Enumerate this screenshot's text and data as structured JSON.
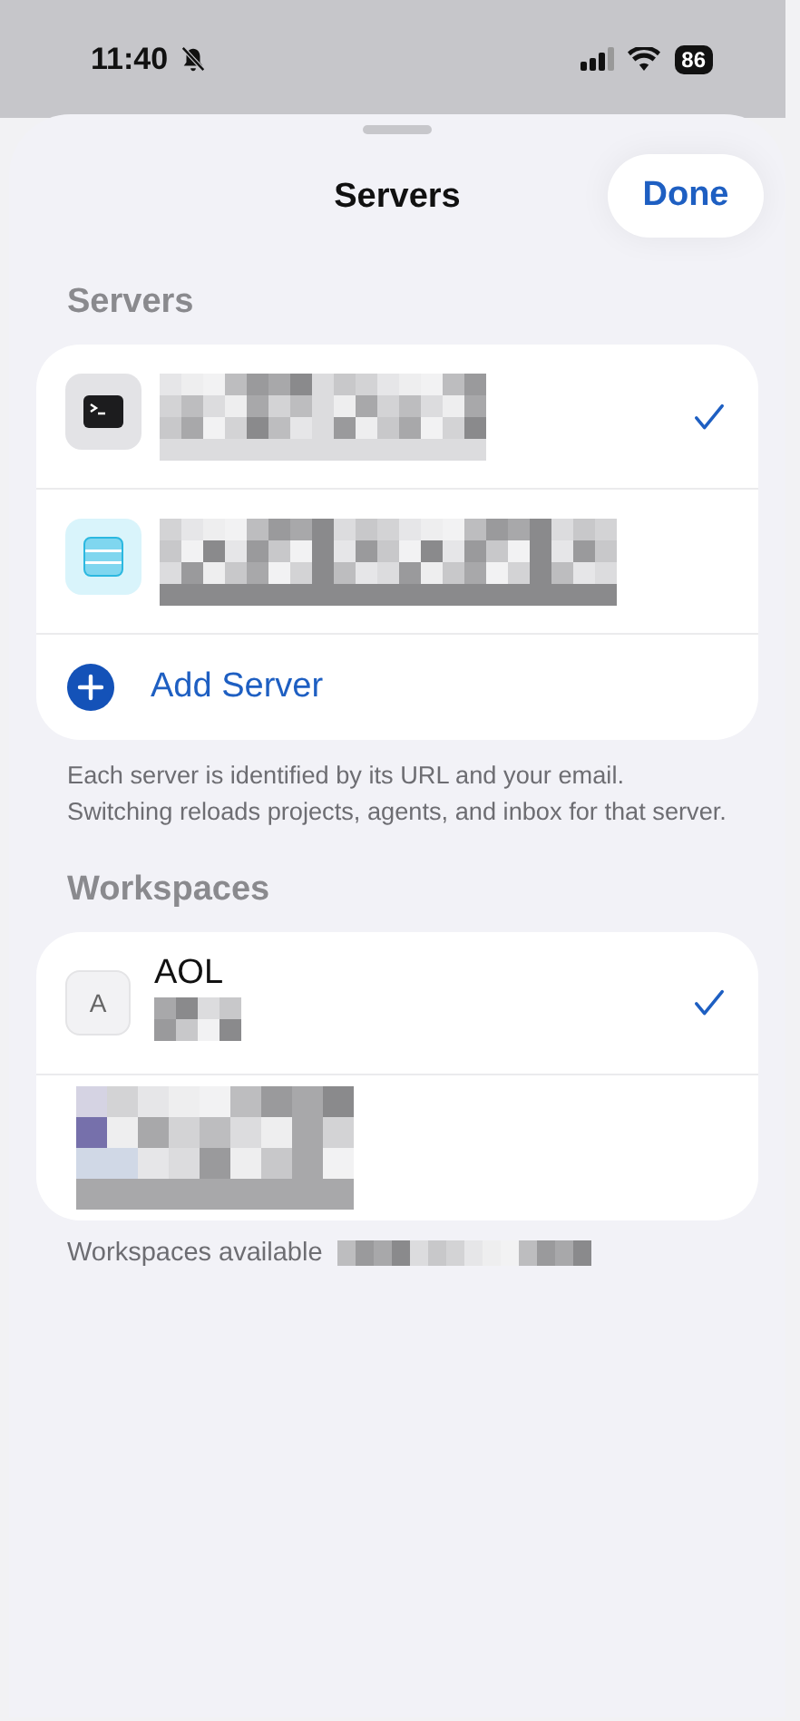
{
  "status_bar": {
    "time": "11:40",
    "battery": "86"
  },
  "sheet": {
    "title": "Servers",
    "done_button": "Done"
  },
  "servers": {
    "header": "Servers",
    "items": [
      {
        "kind": "terminal",
        "selected": true
      },
      {
        "kind": "storage",
        "selected": false
      }
    ],
    "add_label": "Add Server",
    "footer": "Each server is identified by its URL and your email. Switching reloads projects, agents, and inbox for that server."
  },
  "workspaces": {
    "header": "Workspaces",
    "items": [
      {
        "kind": "letter",
        "initial": "A",
        "name": "AOL",
        "selected": true
      },
      {
        "kind": "redacted",
        "selected": false
      }
    ],
    "footer": "Workspaces available"
  }
}
